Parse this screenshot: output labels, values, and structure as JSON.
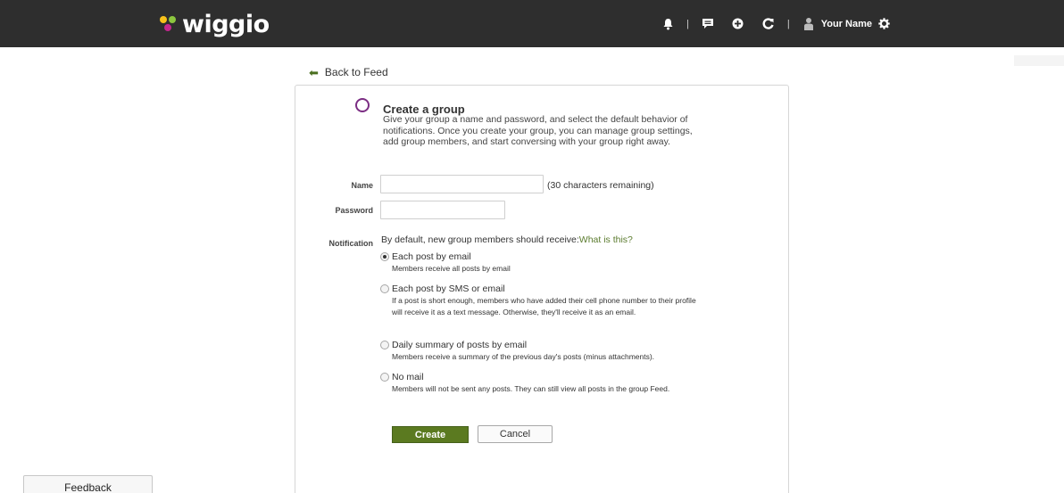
{
  "brand": {
    "name": "wiggio",
    "dot_colors": [
      "#f7c11a",
      "#8cc63f",
      "#c2278e"
    ]
  },
  "topnav": {
    "user_name": "Your Name",
    "separator": "|",
    "icons": [
      "bell-icon",
      "message-icon",
      "plus-circle-icon",
      "refresh-icon",
      "user-icon",
      "gear-icon"
    ]
  },
  "back_link": {
    "label": "Back to Feed"
  },
  "form": {
    "title": "Create a group",
    "description": "Give your group a name and password, and select the default behavior of notifications. Once you create your group, you can manage group settings, add group members, and start conversing with your group right away.",
    "name_label": "Name",
    "name_value": "",
    "name_hint": "(30 characters remaining)",
    "password_label": "Password",
    "password_value": "",
    "notification_label": "Notification",
    "notification_text": "By default, new group members should receive:",
    "what_link": "What is this?",
    "options": [
      {
        "label": "Each post by email",
        "sub": "Members receive all posts by email",
        "checked": true
      },
      {
        "label": "Each post by SMS or email",
        "sub": "If a post is short enough, members who have added their cell phone number to their profile will receive it as a text message. Otherwise, they'll receive it as an email.",
        "checked": false
      },
      {
        "label": "Daily summary of posts by email",
        "sub": "Members receive a summary of the previous day's posts (minus attachments).",
        "checked": false
      },
      {
        "label": "No mail",
        "sub": "Members will not be sent any posts. They can still view all posts in the group Feed.",
        "checked": false
      }
    ],
    "create_label": "Create",
    "cancel_label": "Cancel"
  },
  "feedback": {
    "label": "Feedback"
  },
  "colors": {
    "topbar": "#2e2e2e",
    "accent_green": "#5b7a20",
    "purple": "#7b2d83",
    "link_green": "#5b7b2e"
  }
}
